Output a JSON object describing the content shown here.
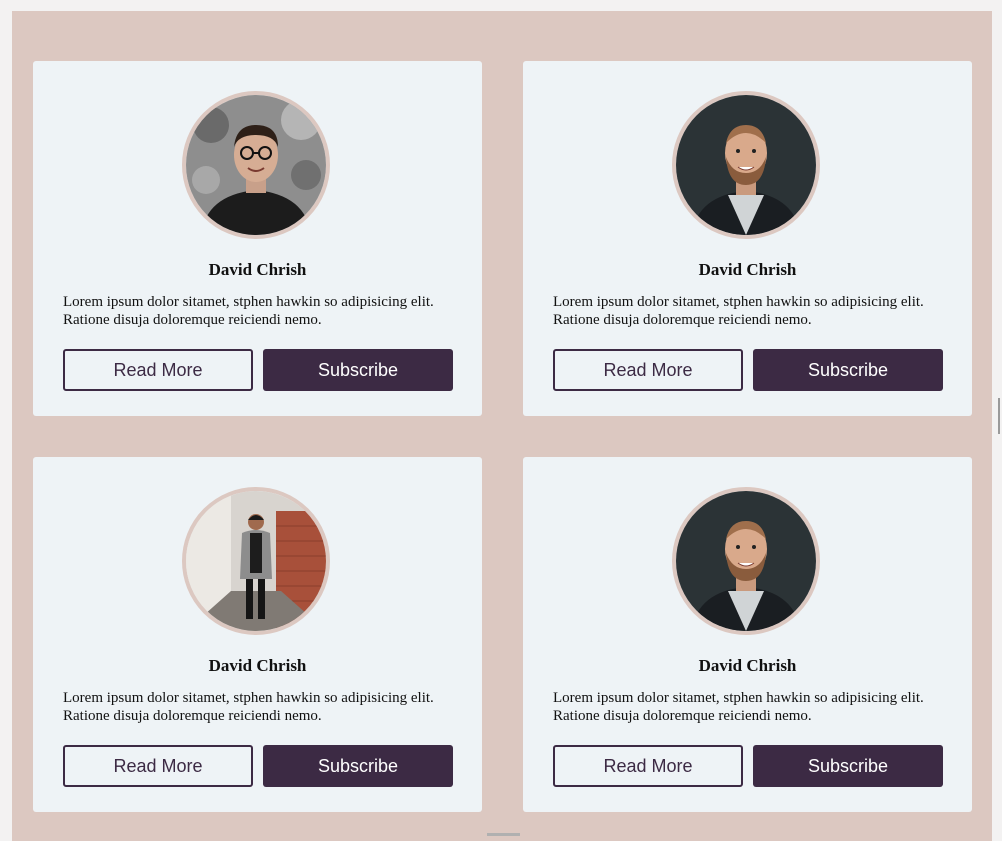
{
  "colors": {
    "page_bg": "#dcc8c1",
    "card_bg": "#eef3f6",
    "button": "#3c2a44",
    "button_text": "#ffffff"
  },
  "cards": [
    {
      "name": "David Chrish",
      "description": "Lorem ipsum dolor sitamet, stphen hawkin so adipisicing elit. Ratione disuja doloremque reiciendi nemo.",
      "read_more": "Read More",
      "subscribe": "Subscribe",
      "avatar_icon": "person-with-glasses-photo"
    },
    {
      "name": "David Chrish",
      "description": "Lorem ipsum dolor sitamet, stphen hawkin so adipisicing elit. Ratione disuja doloremque reiciendi nemo.",
      "read_more": "Read More",
      "subscribe": "Subscribe",
      "avatar_icon": "bearded-man-photo"
    },
    {
      "name": "David Chrish",
      "description": "Lorem ipsum dolor sitamet, stphen hawkin so adipisicing elit. Ratione disuja doloremque reiciendi nemo.",
      "read_more": "Read More",
      "subscribe": "Subscribe",
      "avatar_icon": "man-in-alley-photo"
    },
    {
      "name": "David Chrish",
      "description": "Lorem ipsum dolor sitamet, stphen hawkin so adipisicing elit. Ratione disuja doloremque reiciendi nemo.",
      "read_more": "Read More",
      "subscribe": "Subscribe",
      "avatar_icon": "bearded-man-photo"
    }
  ]
}
